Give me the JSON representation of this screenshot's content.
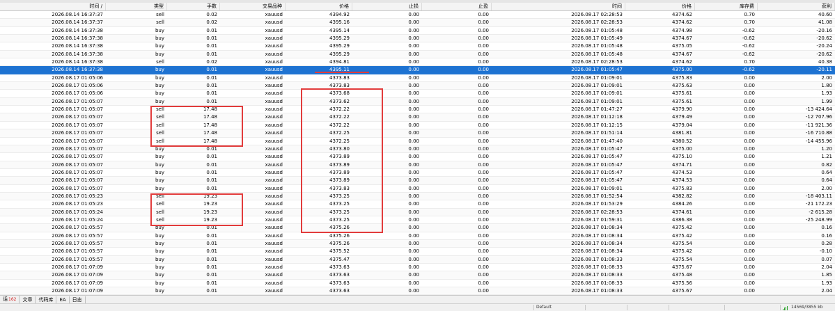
{
  "columns": [
    "时间 /",
    "类型",
    "手数",
    "交易品种",
    "价格",
    "止损",
    "止盈",
    "时间",
    "价格",
    "库存费",
    "获利"
  ],
  "rows": [
    [
      "2026.08.14 16:37:37",
      "sell",
      "0.02",
      "xauusd",
      "4394.92",
      "0.00",
      "0.00",
      "2026.08.17 02:28:53",
      "4374.62",
      "0.70",
      "40.60"
    ],
    [
      "2026.08.14 16:37:37",
      "sell",
      "0.02",
      "xauusd",
      "4395.16",
      "0.00",
      "0.00",
      "2026.08.17 02:28:53",
      "4374.62",
      "0.70",
      "41.08"
    ],
    [
      "2026.08.14 16:37:38",
      "buy",
      "0.01",
      "xauusd",
      "4395.14",
      "0.00",
      "0.00",
      "2026.08.17 01:05:48",
      "4374.98",
      "-0.62",
      "-20.16"
    ],
    [
      "2026.08.14 16:37:38",
      "buy",
      "0.01",
      "xauusd",
      "4395.29",
      "0.00",
      "0.00",
      "2026.08.17 01:05:49",
      "4374.67",
      "-0.62",
      "-20.62"
    ],
    [
      "2026.08.14 16:37:38",
      "buy",
      "0.01",
      "xauusd",
      "4395.29",
      "0.00",
      "0.00",
      "2026.08.17 01:05:48",
      "4375.05",
      "-0.62",
      "-20.24"
    ],
    [
      "2026.08.14 16:37:38",
      "buy",
      "0.01",
      "xauusd",
      "4395.29",
      "0.00",
      "0.00",
      "2026.08.17 01:05:48",
      "4374.67",
      "-0.62",
      "-20.62"
    ],
    [
      "2026.08.14 16:37:38",
      "sell",
      "0.02",
      "xauusd",
      "4394.81",
      "0.00",
      "0.00",
      "2026.08.17 02:28:53",
      "4374.62",
      "0.70",
      "40.38"
    ],
    [
      "2026.08.14 16:37:38",
      "buy",
      "0.01",
      "xauusd",
      "4395.11",
      "0.00",
      "0.00",
      "2026.08.17 01:05:47",
      "4375.00",
      "-0.62",
      "-20.11"
    ],
    [
      "2026.08.17 01:05:06",
      "buy",
      "0.01",
      "xauusd",
      "4373.83",
      "0.00",
      "0.00",
      "2026.08.17 01:09:01",
      "4375.83",
      "0.00",
      "2.00"
    ],
    [
      "2026.08.17 01:05:06",
      "buy",
      "0.01",
      "xauusd",
      "4373.83",
      "0.00",
      "0.00",
      "2026.08.17 01:09:01",
      "4375.63",
      "0.00",
      "1.80"
    ],
    [
      "2026.08.17 01:05:06",
      "buy",
      "0.01",
      "xauusd",
      "4373.68",
      "0.00",
      "0.00",
      "2026.08.17 01:09:01",
      "4375.61",
      "0.00",
      "1.93"
    ],
    [
      "2026.08.17 01:05:07",
      "buy",
      "0.01",
      "xauusd",
      "4373.62",
      "0.00",
      "0.00",
      "2026.08.17 01:09:01",
      "4375.61",
      "0.00",
      "1.99"
    ],
    [
      "2026.08.17 01:05:07",
      "sell",
      "17.48",
      "xauusd",
      "4372.22",
      "0.00",
      "0.00",
      "2026.08.17 01:47:27",
      "4379.90",
      "0.00",
      "-13 424.64"
    ],
    [
      "2026.08.17 01:05:07",
      "sell",
      "17.48",
      "xauusd",
      "4372.22",
      "0.00",
      "0.00",
      "2026.08.17 01:12:18",
      "4379.49",
      "0.00",
      "-12 707.96"
    ],
    [
      "2026.08.17 01:05:07",
      "sell",
      "17.48",
      "xauusd",
      "4372.22",
      "0.00",
      "0.00",
      "2026.08.17 01:12:15",
      "4379.04",
      "0.00",
      "-11 921.36"
    ],
    [
      "2026.08.17 01:05:07",
      "sell",
      "17.48",
      "xauusd",
      "4372.25",
      "0.00",
      "0.00",
      "2026.08.17 01:51:14",
      "4381.81",
      "0.00",
      "-16 710.88"
    ],
    [
      "2026.08.17 01:05:07",
      "sell",
      "17.48",
      "xauusd",
      "4372.25",
      "0.00",
      "0.00",
      "2026.08.17 01:47:40",
      "4380.52",
      "0.00",
      "-14 455.96"
    ],
    [
      "2026.08.17 01:05:07",
      "buy",
      "0.01",
      "xauusd",
      "4373.80",
      "0.00",
      "0.00",
      "2026.08.17 01:05:47",
      "4375.00",
      "0.00",
      "1.20"
    ],
    [
      "2026.08.17 01:05:07",
      "buy",
      "0.01",
      "xauusd",
      "4373.89",
      "0.00",
      "0.00",
      "2026.08.17 01:05:47",
      "4375.10",
      "0.00",
      "1.21"
    ],
    [
      "2026.08.17 01:05:07",
      "buy",
      "0.01",
      "xauusd",
      "4373.89",
      "0.00",
      "0.00",
      "2026.08.17 01:05:47",
      "4374.71",
      "0.00",
      "0.82"
    ],
    [
      "2026.08.17 01:05:07",
      "buy",
      "0.01",
      "xauusd",
      "4373.89",
      "0.00",
      "0.00",
      "2026.08.17 01:05:47",
      "4374.53",
      "0.00",
      "0.64"
    ],
    [
      "2026.08.17 01:05:07",
      "buy",
      "0.01",
      "xauusd",
      "4373.89",
      "0.00",
      "0.00",
      "2026.08.17 01:05:47",
      "4374.53",
      "0.00",
      "0.64"
    ],
    [
      "2026.08.17 01:05:07",
      "buy",
      "0.01",
      "xauusd",
      "4373.83",
      "0.00",
      "0.00",
      "2026.08.17 01:09:01",
      "4375.83",
      "0.00",
      "2.00"
    ],
    [
      "2026.08.17 01:05:23",
      "sell",
      "19.23",
      "xauusd",
      "4373.25",
      "0.00",
      "0.00",
      "2026.08.17 01:52:54",
      "4382.82",
      "0.00",
      "-18 403.11"
    ],
    [
      "2026.08.17 01:05:23",
      "sell",
      "19.23",
      "xauusd",
      "4373.25",
      "0.00",
      "0.00",
      "2026.08.17 01:53:29",
      "4384.26",
      "0.00",
      "-21 172.23"
    ],
    [
      "2026.08.17 01:05:24",
      "sell",
      "19.23",
      "xauusd",
      "4373.25",
      "0.00",
      "0.00",
      "2026.08.17 02:28:53",
      "4374.61",
      "0.00",
      "-2 615.28"
    ],
    [
      "2026.08.17 01:05:24",
      "sell",
      "19.23",
      "xauusd",
      "4373.25",
      "0.00",
      "0.00",
      "2026.08.17 01:59:31",
      "4386.38",
      "0.00",
      "-25 248.99"
    ],
    [
      "2026.08.17 01:05:57",
      "buy",
      "0.01",
      "xauusd",
      "4375.26",
      "0.00",
      "0.00",
      "2026.08.17 01:08:34",
      "4375.42",
      "0.00",
      "0.16"
    ],
    [
      "2026.08.17 01:05:57",
      "buy",
      "0.01",
      "xauusd",
      "4375.26",
      "0.00",
      "0.00",
      "2026.08.17 01:08:34",
      "4375.42",
      "0.00",
      "0.16"
    ],
    [
      "2026.08.17 01:05:57",
      "buy",
      "0.01",
      "xauusd",
      "4375.26",
      "0.00",
      "0.00",
      "2026.08.17 01:08:34",
      "4375.54",
      "0.00",
      "0.28"
    ],
    [
      "2026.08.17 01:05:57",
      "buy",
      "0.01",
      "xauusd",
      "4375.52",
      "0.00",
      "0.00",
      "2026.08.17 01:08:34",
      "4375.42",
      "0.00",
      "-0.10"
    ],
    [
      "2026.08.17 01:05:57",
      "buy",
      "0.01",
      "xauusd",
      "4375.47",
      "0.00",
      "0.00",
      "2026.08.17 01:08:33",
      "4375.54",
      "0.00",
      "0.07"
    ],
    [
      "2026.08.17 01:07:09",
      "buy",
      "0.01",
      "xauusd",
      "4373.63",
      "0.00",
      "0.00",
      "2026.08.17 01:08:33",
      "4375.67",
      "0.00",
      "2.04"
    ],
    [
      "2026.08.17 01:07:09",
      "buy",
      "0.01",
      "xauusd",
      "4373.63",
      "0.00",
      "0.00",
      "2026.08.17 01:08:33",
      "4375.48",
      "0.00",
      "1.85"
    ],
    [
      "2026.08.17 01:07:09",
      "buy",
      "0.01",
      "xauusd",
      "4373.63",
      "0.00",
      "0.00",
      "2026.08.17 01:08:33",
      "4375.56",
      "0.00",
      "1.93"
    ],
    [
      "2026.08.17 01:07:09",
      "buy",
      "0.01",
      "xauusd",
      "4373.63",
      "0.00",
      "0.00",
      "2026.08.17 01:08:33",
      "4375.67",
      "0.00",
      "2.04"
    ]
  ],
  "selected_row_index": 7,
  "tabs": [
    {
      "label": "话",
      "badge": "162"
    },
    {
      "label": "文章"
    },
    {
      "label": "代码库"
    },
    {
      "label": "EA"
    },
    {
      "label": "日志"
    }
  ],
  "status": {
    "profile": "Default",
    "traffic": "14569/3855 kb"
  },
  "colors": {
    "selected_row": "#1e73d2",
    "highlight": "#e23c3c",
    "badge": "#d21e1e",
    "connection": "#2ea32e"
  }
}
